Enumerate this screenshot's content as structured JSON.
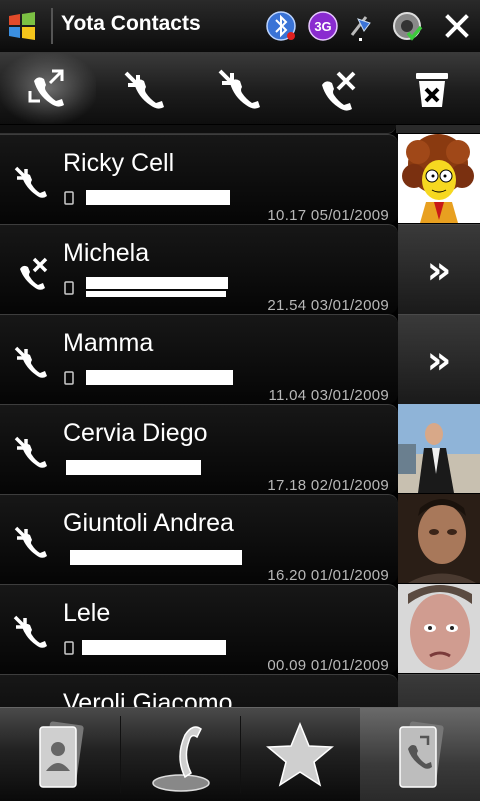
{
  "status_bar": {
    "app_title": "Yota Contacts",
    "network_badge": "3G",
    "icons": [
      "windows-start-icon",
      "bluetooth-icon",
      "3g-icon",
      "signal-icon",
      "sync-ok-icon",
      "close-icon"
    ]
  },
  "toolbar": {
    "buttons": [
      {
        "name": "all-calls",
        "icon": "all-calls-icon",
        "active": true
      },
      {
        "name": "incoming-calls",
        "icon": "incoming-call-icon",
        "active": false
      },
      {
        "name": "outgoing-calls",
        "icon": "outgoing-call-icon",
        "active": false
      },
      {
        "name": "missed-calls",
        "icon": "missed-call-icon",
        "active": false
      },
      {
        "name": "delete",
        "icon": "trash-icon",
        "active": false
      }
    ]
  },
  "call_log": [
    {
      "name": "Ricky Cell",
      "type": "incoming",
      "time": "10.17",
      "date": "05/01/2009",
      "side": "photo"
    },
    {
      "name": "Michela",
      "type": "missed",
      "time": "21.54",
      "date": "03/01/2009",
      "side": "more"
    },
    {
      "name": "Mamma",
      "type": "incoming",
      "time": "11.04",
      "date": "03/01/2009",
      "side": "more"
    },
    {
      "name": "Cervia Diego",
      "type": "incoming",
      "time": "17.18",
      "date": "02/01/2009",
      "side": "photo"
    },
    {
      "name": "Giuntoli Andrea",
      "type": "incoming",
      "time": "16.20",
      "date": "01/01/2009",
      "side": "photo"
    },
    {
      "name": "Lele",
      "type": "outgoing",
      "time": "00.09",
      "date": "01/01/2009",
      "side": "photo"
    },
    {
      "name": "Veroli Giacomo",
      "type": "incoming",
      "time": "",
      "date": "",
      "side": "blank"
    }
  ],
  "more_glyph": "»",
  "bottom_tabs": [
    {
      "name": "contacts",
      "icon": "contacts-card-icon",
      "active": false
    },
    {
      "name": "phone",
      "icon": "phone-handset-icon",
      "active": false
    },
    {
      "name": "favorites",
      "icon": "star-icon",
      "active": false
    },
    {
      "name": "call-history",
      "icon": "call-history-icon",
      "active": true
    }
  ],
  "colors": {
    "background": "#000000",
    "row": "#0b0b0b",
    "timestamp": "#b8b8b8",
    "badge_3g": "#8a2bd0"
  }
}
